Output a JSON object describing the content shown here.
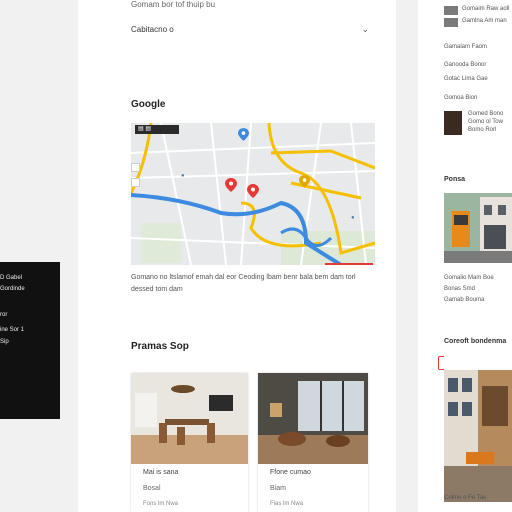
{
  "main": {
    "top_blurb": "Gomam bor tof thuip bu",
    "dropdown_label": "Cabitacno o",
    "map_section": {
      "title": "Google",
      "caption": "Gomano no ltslamof emah dal eor Ceoding lbam benr bala bem dam torl dessed tom dam"
    },
    "section2": {
      "title": "Pramas Sop",
      "cards": [
        {
          "line1": "Mai is sana",
          "line2": "Bosal",
          "line3": "Fons lm Nwa"
        },
        {
          "line1": "Ffone cumao",
          "line2": "Biam",
          "line3": "Fias lm Nwa"
        }
      ]
    }
  },
  "sidebar": {
    "blurbs": [
      "Gomaim Raw aoll",
      "Gamlna Am man",
      "Gamalam Faom",
      "Ganooda Bonor",
      "Gotac Lima Gae",
      "Gomoa Bion",
      "Colme o Fe Tao"
    ],
    "avatar_lines": [
      "Gomed Bono",
      "Gomo ol Tow",
      "Bomo Rorl"
    ],
    "heading1": "Ponsa",
    "captions": [
      "Gomalio Mam Boe",
      "Bonas Smd",
      "Gamab Bouma"
    ],
    "heading2": "Coreoft bondenma"
  },
  "dark_card": {
    "lines": [
      "D Gabel",
      "Gordinde",
      "ror",
      "ine Sor 1",
      "Sip"
    ]
  },
  "colors": {
    "accent_red": "#e53935",
    "map_road_yellow": "#f6c000",
    "map_water_blue": "#3d8be0"
  }
}
